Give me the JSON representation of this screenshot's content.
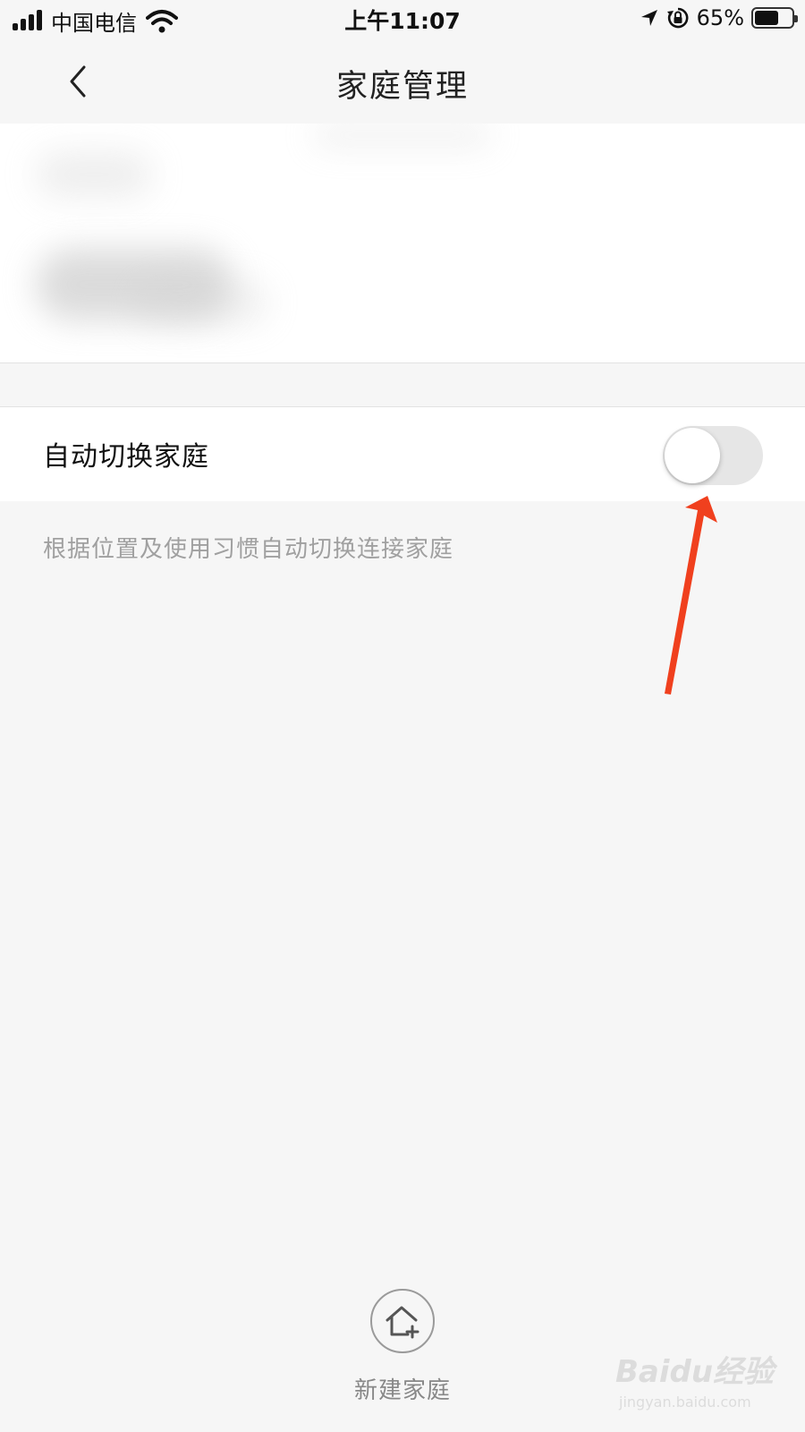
{
  "status_bar": {
    "carrier": "中国电信",
    "time": "上午11:07",
    "battery_percent": "65%",
    "battery_level": 0.65,
    "icons": [
      "signal-icon",
      "wifi-icon",
      "location-icon",
      "rotation-lock-icon",
      "battery-icon"
    ]
  },
  "nav": {
    "title": "家庭管理",
    "back_icon": "chevron-left-icon"
  },
  "settings": {
    "auto_switch_label": "自动切换家庭",
    "auto_switch_enabled": false,
    "auto_switch_description": "根据位置及使用习惯自动切换连接家庭"
  },
  "footer": {
    "new_family_label": "新建家庭",
    "new_family_icon": "home-add-icon"
  },
  "watermark": {
    "brand": "Baidu经验",
    "url": "jingyan.baidu.com"
  },
  "colors": {
    "background": "#f6f6f6",
    "annotation_arrow": "#f0401e",
    "toggle_off": "#e6e6e6",
    "description_text": "#a0a0a0"
  }
}
